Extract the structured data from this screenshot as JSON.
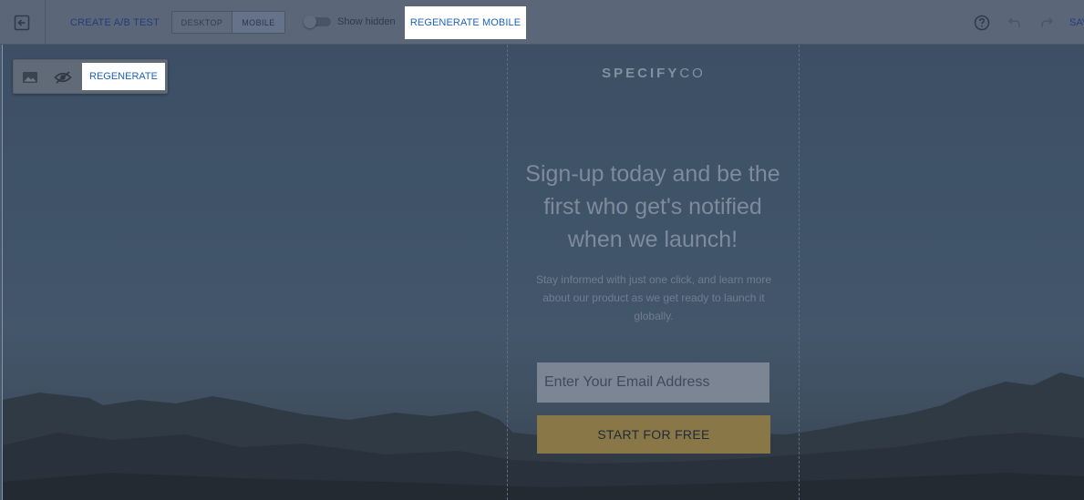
{
  "toolbar": {
    "exit_icon": "exit-editor-icon",
    "create_ab_test_label": "CREATE A/B TEST",
    "device_tabs": [
      {
        "label": "DESKTOP",
        "selected": false
      },
      {
        "label": "MOBILE",
        "selected": true
      }
    ],
    "show_hidden_label": "Show hidden",
    "show_hidden_enabled": false,
    "regenerate_mobile_label": "REGENERATE MOBILE",
    "help_icon": "help-circle-icon",
    "undo_icon": "undo-icon",
    "redo_icon": "redo-icon",
    "save_label": "SAVE"
  },
  "element_toolbar": {
    "icons": [
      "image-icon",
      "hide-eye-icon"
    ],
    "regenerate_label": "REGENERATE"
  },
  "landing_page": {
    "logo_bold": "SPECIFY",
    "logo_light": "CO",
    "headline": "Sign-up today and be the first who get's notified when we launch!",
    "subtext": "Stay informed with just one click, and learn more about our product as we get ready to launch it globally.",
    "email_placeholder": "Enter Your Email Address",
    "cta_label": "START FOR FREE"
  },
  "colors": {
    "toolbar_bg": "#5b6778",
    "link_blue": "#1f63b8",
    "cta_bg": "#8a7748",
    "overlay": "#3f5369"
  }
}
